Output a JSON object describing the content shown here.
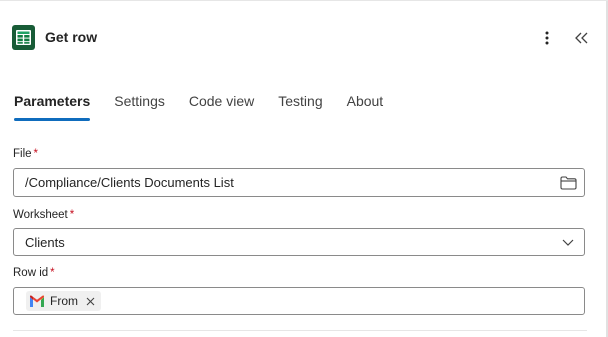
{
  "header": {
    "title": "Get row",
    "app_icon": "excel-online-icon",
    "more_icon": "more-vertical-icon",
    "collapse_icon": "double-chevron-left-icon"
  },
  "tabs": [
    {
      "label": "Parameters",
      "active": true
    },
    {
      "label": "Settings",
      "active": false
    },
    {
      "label": "Code view",
      "active": false
    },
    {
      "label": "Testing",
      "active": false
    },
    {
      "label": "About",
      "active": false
    }
  ],
  "fields": {
    "file": {
      "label": "File",
      "required": "*",
      "value": "/Compliance/Clients Documents List",
      "icon": "folder-icon"
    },
    "worksheet": {
      "label": "Worksheet",
      "required": "*",
      "value": "Clients",
      "icon": "chevron-down-icon"
    },
    "row_id": {
      "label": "Row id",
      "required": "*",
      "token_label": "From",
      "token_icon": "gmail-icon",
      "token_close_icon": "close-icon"
    }
  },
  "colors": {
    "accent": "#0f6cbd",
    "required": "#c50f1f",
    "excel_green": "#107c41"
  }
}
